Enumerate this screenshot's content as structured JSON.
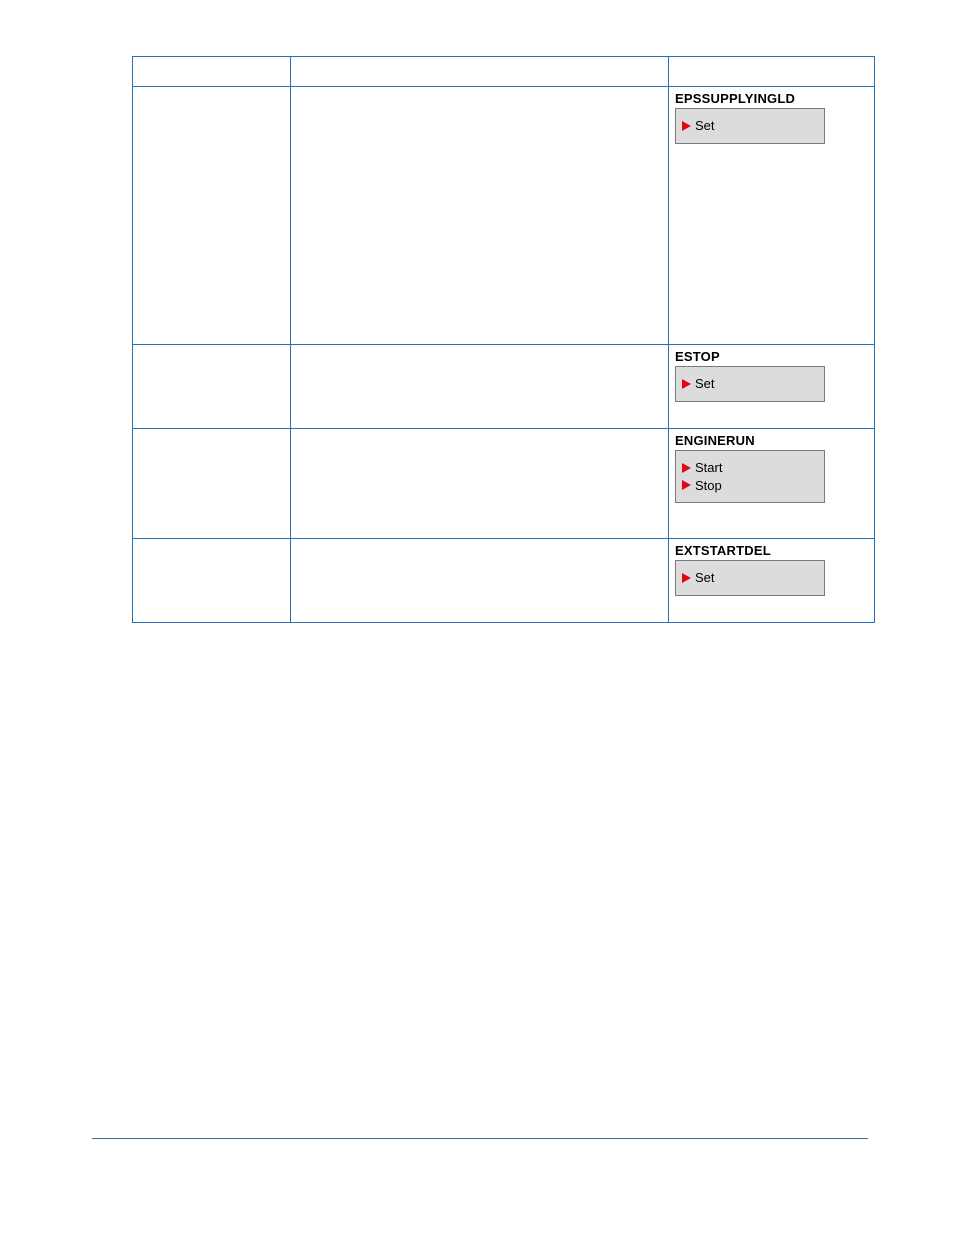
{
  "rows": [
    {
      "title": "EPSSUPPLYINGLD",
      "items": [
        {
          "label": "Set"
        }
      ]
    },
    {
      "title": "ESTOP",
      "items": [
        {
          "label": "Set"
        }
      ]
    },
    {
      "title": "ENGINERUN",
      "items": [
        {
          "label": "Start"
        },
        {
          "label": "Stop"
        }
      ]
    },
    {
      "title": "EXTSTARTDEL",
      "items": [
        {
          "label": "Set"
        }
      ]
    }
  ]
}
